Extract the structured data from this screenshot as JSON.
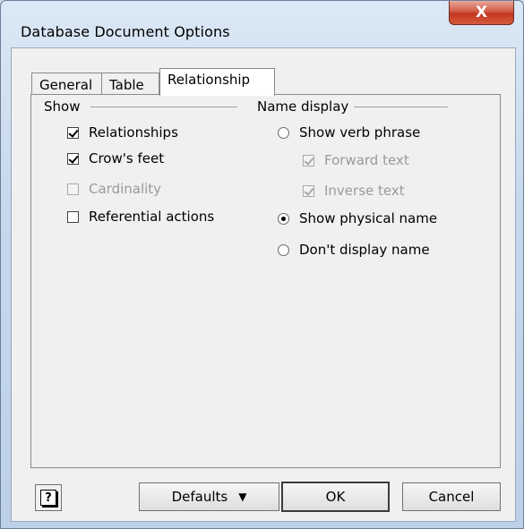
{
  "window": {
    "title": "Database Document Options",
    "close_glyph": "X"
  },
  "tabs": [
    {
      "label": "General",
      "active": false
    },
    {
      "label": "Table",
      "active": false
    },
    {
      "label": "Relationship",
      "active": true
    }
  ],
  "show_group": {
    "label": "Show",
    "options": [
      {
        "label": "Relationships",
        "checked": true,
        "enabled": true
      },
      {
        "label": "Crow's feet",
        "checked": true,
        "enabled": true
      },
      {
        "label": "Cardinality",
        "checked": false,
        "enabled": false
      },
      {
        "label": "Referential actions",
        "checked": false,
        "enabled": true
      }
    ]
  },
  "name_display_group": {
    "label": "Name display",
    "options": [
      {
        "label": "Show verb phrase",
        "selected": false
      },
      {
        "label": "Show physical name",
        "selected": true
      },
      {
        "label": "Don't display name",
        "selected": false
      }
    ],
    "sub_options": [
      {
        "label": "Forward text",
        "checked": true,
        "enabled": false
      },
      {
        "label": "Inverse text",
        "checked": true,
        "enabled": false
      }
    ]
  },
  "buttons": {
    "help_glyph": "?",
    "defaults_label": "Defaults",
    "ok_label": "OK",
    "cancel_label": "Cancel"
  },
  "icons": {
    "close": "close-icon",
    "help": "help-icon",
    "dropdown": "caret-down-icon"
  }
}
